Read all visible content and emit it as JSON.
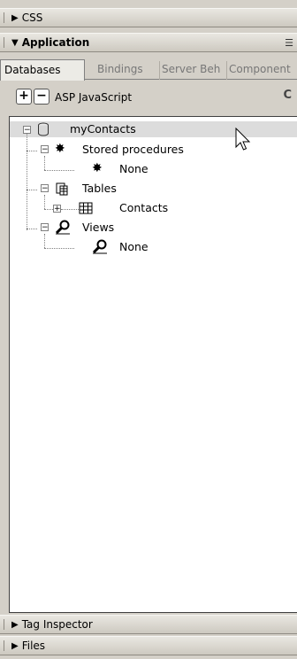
{
  "panels": {
    "css": {
      "title": "CSS"
    },
    "application": {
      "title": "Application"
    },
    "tag_inspector": {
      "title": "Tag Inspector"
    },
    "files": {
      "title": "Files"
    }
  },
  "tabs": [
    "Databases",
    "Bindings",
    "Server Beh",
    "Component"
  ],
  "active_tab": "Databases",
  "toolbar": {
    "add_label": "+",
    "remove_label": "−",
    "document_type": "ASP JavaScript",
    "truncated_text": "C"
  },
  "tree": {
    "connection": "myContacts",
    "stored_procedures": {
      "label": "Stored procedures",
      "child": "None"
    },
    "tables": {
      "label": "Tables",
      "child": "Contacts"
    },
    "views": {
      "label": "Views",
      "child": "None"
    }
  },
  "colors": {
    "panel_bg": "#d4d0c8",
    "tree_bg": "#ffffff",
    "selection": "#dcdcdc"
  },
  "icons": [
    "database-icon",
    "stored-procedure-icon",
    "table-group-icon",
    "table-icon",
    "view-icon",
    "options-menu-icon",
    "mouse-cursor-icon"
  ]
}
